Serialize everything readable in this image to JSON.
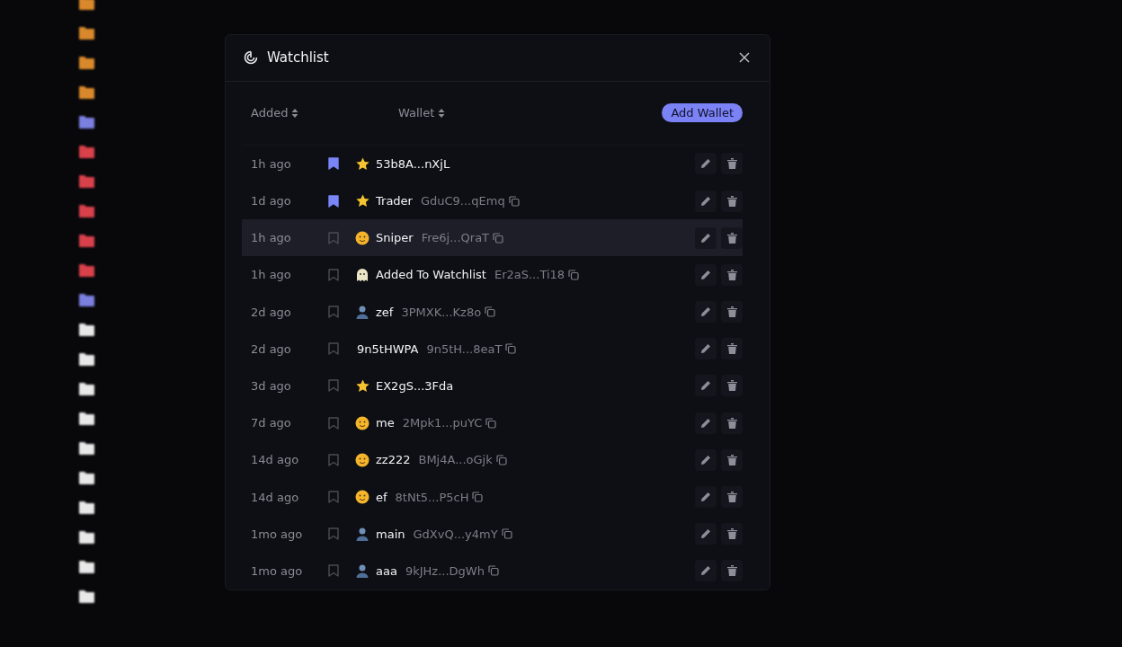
{
  "background_folders": [
    {
      "color": "#d9892b"
    },
    {
      "color": "#d9892b"
    },
    {
      "color": "#d9892b"
    },
    {
      "color": "#d9892b"
    },
    {
      "color": "#7b7fe0"
    },
    {
      "color": "#d8404a"
    },
    {
      "color": "#d8404a"
    },
    {
      "color": "#d8404a"
    },
    {
      "color": "#d8404a"
    },
    {
      "color": "#d8404a"
    },
    {
      "color": "#7b7fe0"
    },
    {
      "color": "#e8e8e8"
    },
    {
      "color": "#e8e8e8"
    },
    {
      "color": "#e8e8e8"
    },
    {
      "color": "#e8e8e8"
    },
    {
      "color": "#e8e8e8"
    },
    {
      "color": "#e8e8e8"
    },
    {
      "color": "#e8e8e8"
    },
    {
      "color": "#e8e8e8"
    },
    {
      "color": "#e8e8e8"
    },
    {
      "color": "#e8e8e8"
    }
  ],
  "dialog": {
    "title": "Watchlist",
    "columns": [
      {
        "label": "Added",
        "sortable": true
      },
      {
        "label": "Wallet",
        "sortable": true
      }
    ],
    "add_button": "Add Wallet",
    "rows": [
      {
        "added": "1h ago",
        "bookmarked": true,
        "highlighted": false,
        "kind": "star",
        "name": "53b8A...nXjL"
      },
      {
        "added": "1d ago",
        "bookmarked": true,
        "highlighted": false,
        "kind": "star",
        "name": "Trader",
        "address": "GduC9...qEmq"
      },
      {
        "added": "1h ago",
        "bookmarked": false,
        "highlighted": true,
        "kind": "face",
        "name": "Sniper",
        "address": "Fre6j...QraT"
      },
      {
        "added": "1h ago",
        "bookmarked": false,
        "highlighted": false,
        "kind": "ghost",
        "name": "Added To Watchlist",
        "address": "Er2aS...Ti18"
      },
      {
        "added": "2d ago",
        "bookmarked": false,
        "highlighted": false,
        "kind": "person",
        "name": "zef",
        "address": "3PMXK...Kz8o"
      },
      {
        "added": "2d ago",
        "bookmarked": false,
        "highlighted": false,
        "kind": "plain",
        "name": "9n5tHWPA",
        "address": "9n5tH...8eaT"
      },
      {
        "added": "3d ago",
        "bookmarked": false,
        "highlighted": false,
        "kind": "star",
        "name": "EX2gS...3Fda"
      },
      {
        "added": "7d ago",
        "bookmarked": false,
        "highlighted": false,
        "kind": "face",
        "name": "me",
        "address": "2Mpk1...puYC"
      },
      {
        "added": "14d ago",
        "bookmarked": false,
        "highlighted": false,
        "kind": "face",
        "name": "zz222",
        "address": "BMj4A...oGjk"
      },
      {
        "added": "14d ago",
        "bookmarked": false,
        "highlighted": false,
        "kind": "face",
        "name": "ef",
        "address": "8tNt5...P5cH"
      },
      {
        "added": "1mo ago",
        "bookmarked": false,
        "highlighted": false,
        "kind": "person",
        "name": "main",
        "address": "GdXvQ...y4mY"
      },
      {
        "added": "1mo ago",
        "bookmarked": false,
        "highlighted": false,
        "kind": "person",
        "name": "aaa",
        "address": "9kJHz...DgWh"
      }
    ]
  }
}
